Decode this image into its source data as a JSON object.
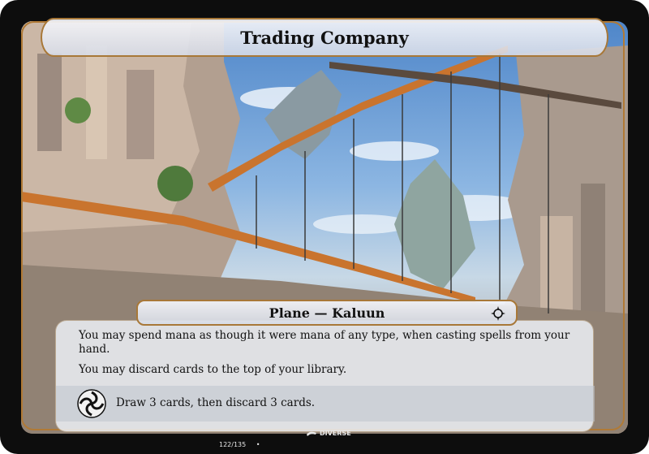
{
  "card": {
    "title": "Trading Company",
    "type_line": "Plane — Kaluun",
    "rules": [
      "You may spend mana as though it were mana of any type, when casting spells from your hand.",
      "You may discard cards to the top of your library."
    ],
    "chaos_ability": "Draw 3 cards, then discard 3 cards.",
    "set_icon": "set-symbol-icon",
    "chaos_icon": "chaos-symbol-icon",
    "artist_icon": "paintbrush-icon",
    "artist": "DIVERSE",
    "collector_number": "122/135",
    "collector_separator": "•"
  },
  "colors": {
    "frame_border": "#b07a36",
    "card_border": "#0d0d0d",
    "sky": "#4f86c9",
    "bridge": "#c9742e"
  }
}
